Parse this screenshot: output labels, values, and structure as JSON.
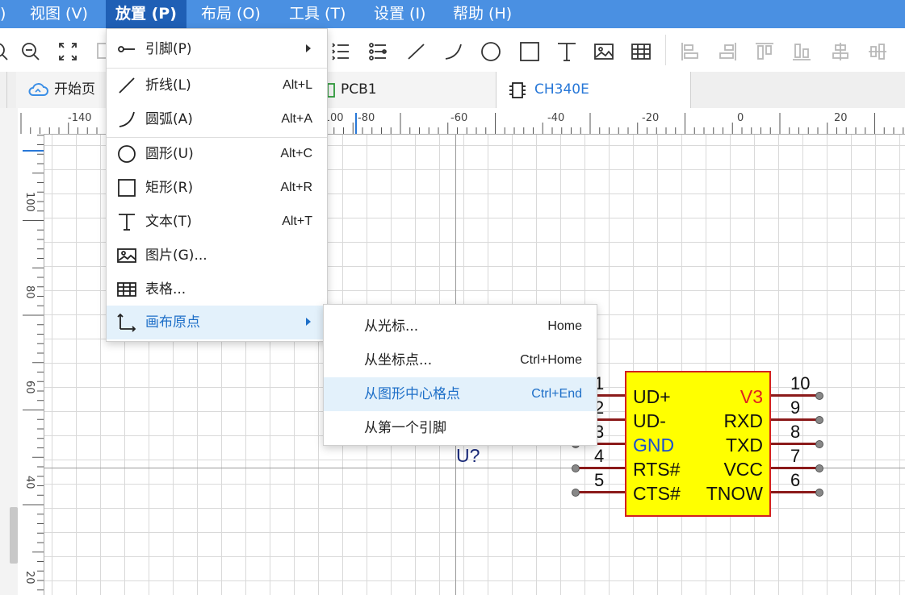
{
  "menubar": {
    "items": [
      ")",
      "视图 (V)",
      "放置 (P)",
      "布局 (O)",
      "工具 (T)",
      "设置 (I)",
      "帮助 (H)"
    ]
  },
  "tabs": {
    "start": "开始页",
    "pcb": "PCB1",
    "schematic": "CH340E"
  },
  "rulers": {
    "horizontal": [
      "-140",
      "-100",
      "-80",
      "-60",
      "-40",
      "-20",
      "0",
      "20"
    ],
    "vertical": [
      "100",
      "80",
      "60",
      "40",
      "20"
    ]
  },
  "place_menu": {
    "items": [
      {
        "label": "引脚(P)",
        "shortcut": "",
        "icon": "pin-icon"
      },
      {
        "label": "折线(L)",
        "shortcut": "Alt+L",
        "icon": "polyline-icon"
      },
      {
        "label": "圆弧(A)",
        "shortcut": "Alt+A",
        "icon": "arc-icon"
      },
      {
        "label": "圆形(U)",
        "shortcut": "Alt+C",
        "icon": "circle-icon"
      },
      {
        "label": "矩形(R)",
        "shortcut": "Alt+R",
        "icon": "rectangle-icon"
      },
      {
        "label": "文本(T)",
        "shortcut": "Alt+T",
        "icon": "text-icon"
      },
      {
        "label": "图片(G)...",
        "shortcut": "",
        "icon": "image-icon"
      },
      {
        "label": "表格...",
        "shortcut": "",
        "icon": "table-icon"
      },
      {
        "label": "画布原点",
        "shortcut": "",
        "icon": "origin-icon"
      }
    ]
  },
  "origin_submenu": {
    "items": [
      {
        "label": "从光标...",
        "shortcut": "Home"
      },
      {
        "label": "从坐标点...",
        "shortcut": "Ctrl+Home"
      },
      {
        "label": "从图形中心格点",
        "shortcut": "Ctrl+End"
      },
      {
        "label": "从第一个引脚",
        "shortcut": ""
      }
    ]
  },
  "component": {
    "designator": "U?",
    "left_pins": [
      {
        "num": "1",
        "name": "UD+"
      },
      {
        "num": "2",
        "name": "UD-"
      },
      {
        "num": "3",
        "name": "GND"
      },
      {
        "num": "4",
        "name": "RTS#"
      },
      {
        "num": "5",
        "name": "CTS#"
      }
    ],
    "right_pins": [
      {
        "num": "10",
        "name": "V3"
      },
      {
        "num": "9",
        "name": "RXD"
      },
      {
        "num": "8",
        "name": "TXD"
      },
      {
        "num": "7",
        "name": "VCC"
      },
      {
        "num": "6",
        "name": "TNOW"
      }
    ],
    "colors": {
      "body": "#ffff00",
      "border": "#d32020",
      "pin": "#8b1a1a",
      "gnd_label": "#1a4fd0",
      "v3_label": "#e02020"
    }
  }
}
